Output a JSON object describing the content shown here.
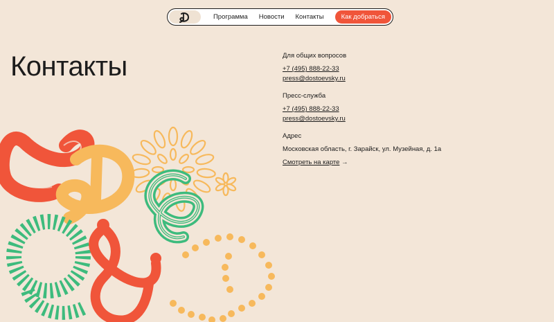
{
  "nav": {
    "items": [
      "Программа",
      "Новости",
      "Контакты"
    ],
    "cta_label": "Как добраться"
  },
  "page": {
    "title": "Контакты"
  },
  "contacts": {
    "general": {
      "heading": "Для общих вопросов",
      "phone": "+7 (495) 888-22-33",
      "email": "press@dostoevsky.ru"
    },
    "press": {
      "heading": "Пресс-служба",
      "phone": "+7 (495) 888-22-33",
      "email": "press@dostoevsky.ru"
    },
    "address": {
      "heading": "Адрес",
      "text": "Московская область, г. Зарайск, ул. Музейная, д. 1а",
      "map_link": "Смотреть на карте",
      "arrow": "→"
    }
  },
  "colors": {
    "background": "#f3e6d8",
    "accent": "#f0553a",
    "yellow": "#f7b95c",
    "green": "#3dbb7d",
    "text": "#1c1c1c"
  }
}
